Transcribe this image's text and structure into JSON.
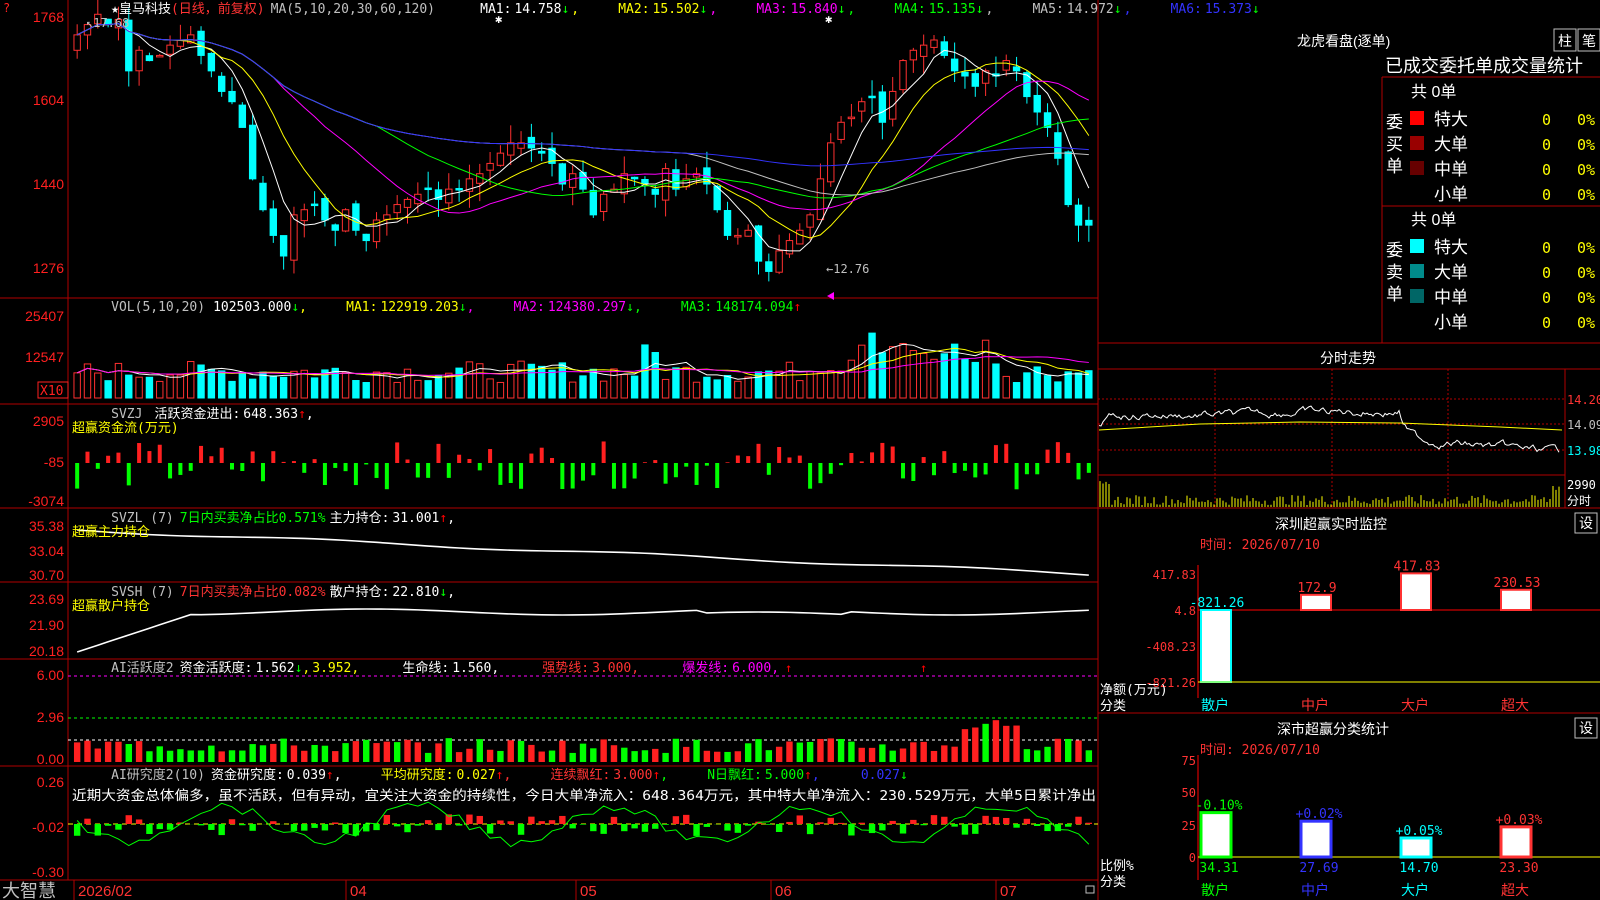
{
  "app": {
    "bottom_brand": "大智慧",
    "stock_name": "皇马科技",
    "stock_mode": "(日线，前复权)",
    "ma_line_label": "MA(5,10,20,30,60,120)",
    "ma_values": [
      {
        "label": "MA1:",
        "value": "14.758",
        "arrow": "↓",
        "color": "#ffffff"
      },
      {
        "label": "MA2:",
        "value": "15.502",
        "arrow": "↓",
        "color": "#ffff00"
      },
      {
        "label": "MA3:",
        "value": "15.840",
        "arrow": "↓",
        "color": "#ff00ff"
      },
      {
        "label": "MA4:",
        "value": "15.135",
        "arrow": "↓",
        "color": "#00ff00"
      },
      {
        "label": "MA5:",
        "value": "14.972",
        "arrow": "↓",
        "color": "#c0c0c0"
      },
      {
        "label": "MA6:",
        "value": "15.373",
        "arrow": "↓",
        "color": "#3333ff"
      }
    ],
    "high_marker": "17.68",
    "low_marker": "←12.76",
    "corner_marker": "?"
  },
  "panels": {
    "price": {
      "ticks": [
        "1768",
        "1604",
        "1440",
        "1276"
      ]
    },
    "volume": {
      "ticks": [
        "25407",
        "12547"
      ],
      "unit": "X10",
      "label": "VOL(5,10,20)",
      "vol": "102503.000",
      "vol_arrow": "↓",
      "mas": [
        {
          "t": "MA1:",
          "v": "122919.203",
          "a": "↓",
          "c": "#ffff00"
        },
        {
          "t": "MA2:",
          "v": "124380.297",
          "a": "↓",
          "c": "#ff00ff"
        },
        {
          "t": "MA3:",
          "v": "148174.094",
          "a": "↑",
          "c": "#00ff00"
        }
      ]
    },
    "svzj": {
      "ticks": [
        "2905",
        "-85",
        "-3074"
      ],
      "label": "SVZJ",
      "line1": "活跃资金进出:",
      "value": "648.363",
      "arrow": "↑",
      "line2": "超赢资金流(万元)"
    },
    "svzl": {
      "ticks": [
        "35.38",
        "33.04",
        "30.70"
      ],
      "label": "SVZL (7)",
      "text1": "7日内买卖净占比0.571%",
      "text2": "主力持仓:",
      "value": "31.001",
      "arrow": "↑",
      "line2": "超赢主力持仓"
    },
    "svsh": {
      "ticks": [
        "23.69",
        "21.90",
        "20.18"
      ],
      "label": "SVSH (7)",
      "text1": "7日内买卖净占比0.082%",
      "text2": "散户持仓:",
      "value": "22.810",
      "arrow": "↓",
      "line2": "超赢散户持仓"
    },
    "ai1": {
      "ticks": [
        "6.00",
        "2.96",
        "0.00"
      ],
      "label": "AI活跃度2",
      "t1": "资金活跃度:",
      "v1": "1.562",
      "a1": "↓",
      "v2": "3.952,",
      "t3": "生命线:",
      "v3": "1.560,",
      "t4": "强势线:",
      "v4": "3.000,",
      "t5": "爆发线:",
      "v5": "6.000,"
    },
    "ai2": {
      "ticks": [
        "0.26",
        "-0.02",
        "-0.30"
      ],
      "label": "AI研究度2(10)",
      "t1": "资金研究度:",
      "v1": "0.039",
      "a1": "↑",
      "t2": "平均研究度:",
      "v2": "0.027",
      "a2": "↑",
      "t3": "连续飘红:",
      "v3": "3.000",
      "a3": "↑",
      "t4": "N日飘红:",
      "v4": "5.000",
      "a4": "↑",
      "v5": "0.027",
      "a5": "↓",
      "comment": "近期大资金总体偏多，虽不活跃，但有异动，宜关注大资金的持续性，今日大单净流入：648.364万元，其中特大单净流入：230.529万元，大单5日累计净出"
    }
  },
  "x_axis": {
    "labels": [
      {
        "t": "2026/02",
        "x": 78
      },
      {
        "t": "04",
        "x": 350
      },
      {
        "t": "05",
        "x": 580
      },
      {
        "t": "06",
        "x": 775
      },
      {
        "t": "07",
        "x": 1000
      }
    ]
  },
  "right": {
    "dragon_title": "龙虎看盘(逐单)",
    "btn_col": "柱",
    "btn_pen": "笔",
    "order_header": "已成交委托单成交量统计",
    "buy": {
      "side": "委买单",
      "total": "共 0单",
      "rows": [
        {
          "name": "特大",
          "v": "0",
          "p": "0%",
          "c": "#ff0000"
        },
        {
          "name": "大单",
          "v": "0",
          "p": "0%",
          "c": "#990000"
        },
        {
          "name": "中单",
          "v": "0",
          "p": "0%",
          "c": "#660000"
        },
        {
          "name": "小单",
          "v": "0",
          "p": "0%",
          "c": "#000000"
        }
      ]
    },
    "sell": {
      "side": "委卖单",
      "total": "共 0单",
      "rows": [
        {
          "name": "特大",
          "v": "0",
          "p": "0%",
          "c": "#00ffff"
        },
        {
          "name": "大单",
          "v": "0",
          "p": "0%",
          "c": "#008b8b"
        },
        {
          "name": "中单",
          "v": "0",
          "p": "0%",
          "c": "#006666"
        },
        {
          "name": "小单",
          "v": "0",
          "p": "0%",
          "c": "#000000"
        }
      ]
    },
    "intraday_title": "分时走势",
    "intraday_ticks": [
      "14.20",
      "14.09",
      "13.98"
    ],
    "intraday_vol_tick": "2990",
    "intraday_vol_label": "分时",
    "monitor_title": "深圳超赢实时监控",
    "monitor_btn": "设",
    "monitor_time": "时间: 2026/07/10",
    "monitor_yticks": [
      "417.83",
      "4.8",
      "-408.23",
      "-821.26"
    ],
    "monitor_bars": [
      {
        "cat": "散户",
        "v": -821.26,
        "label": "-821.26"
      },
      {
        "cat": "中户",
        "v": 172.9,
        "label": "172.9"
      },
      {
        "cat": "大户",
        "v": 417.83,
        "label": "417.83"
      },
      {
        "cat": "超大",
        "v": 230.53,
        "label": "230.53"
      }
    ],
    "monitor_ylabel": "净额(万元)",
    "monitor_xlabel": "分类",
    "stat_title": "深市超赢分类统计",
    "stat_btn": "设",
    "stat_time": "时间: 2026/07/10",
    "stat_yticks": [
      "75",
      "50",
      "25",
      "0"
    ],
    "stat_bars": [
      {
        "cat": "散户",
        "v": 34.31,
        "label": "34.31",
        "chg": "-0.10%"
      },
      {
        "cat": "中户",
        "v": 27.69,
        "label": "27.69",
        "chg": "+0.02%"
      },
      {
        "cat": "大户",
        "v": 14.7,
        "label": "14.70",
        "chg": "+0.05%"
      },
      {
        "cat": "超大",
        "v": 23.3,
        "label": "23.30",
        "chg": "+0.03%"
      }
    ],
    "stat_ylabel": "比例%",
    "stat_xlabel": "分类"
  },
  "chart_data": [
    {
      "type": "candlestick",
      "title": "皇马科技 (日线，前复权)",
      "ylim": [
        12.3,
        17.9
      ],
      "yticks": [
        17.68,
        16.04,
        14.4,
        12.76
      ],
      "x_range": [
        "2026/02",
        "2026/07"
      ],
      "close": [
        17.3,
        17.5,
        17.7,
        17.5,
        17.6,
        16.6,
        17.0,
        16.8,
        16.9,
        17.1,
        17.2,
        17.3,
        16.9,
        16.6,
        16.2,
        16.0,
        15.5,
        14.5,
        13.9,
        13.4,
        13.0,
        13.8,
        13.9,
        14.0,
        13.7,
        13.5,
        13.9,
        13.5,
        13.3,
        13.7,
        13.8,
        14.0,
        14.1,
        14.2,
        14.3,
        14.1,
        14.3,
        14.3,
        14.5,
        14.6,
        14.8,
        15.0,
        15.2,
        15.2,
        15.1,
        15.0,
        14.8,
        14.4,
        14.6,
        14.3,
        13.8,
        14.2,
        14.3,
        14.6,
        14.5,
        14.4,
        14.2,
        14.7,
        14.3,
        14.5,
        14.6,
        14.4,
        13.9,
        13.4,
        13.4,
        13.5,
        12.9,
        12.7,
        13.1,
        13.3,
        13.5,
        13.8,
        14.5,
        15.2,
        15.6,
        15.7,
        16.0,
        16.1,
        15.6,
        16.2,
        16.8,
        17.0,
        17.1,
        17.2,
        16.9,
        16.6,
        16.5,
        16.3,
        16.6,
        16.5,
        16.8,
        16.6,
        16.1,
        15.8,
        15.5,
        14.9,
        14.0,
        13.6,
        13.6
      ],
      "ma_values": {
        "MA1": 14.758,
        "MA2": 15.502,
        "MA3": 15.84,
        "MA4": 15.135,
        "MA5": 14.972,
        "MA6": 15.373
      },
      "high": 17.68,
      "low": 12.76
    },
    {
      "type": "bar",
      "title": "VOL(5,10,20)",
      "ylim": [
        0,
        25407
      ],
      "last": 102503.0,
      "ma": {
        "MA1": 122919.203,
        "MA2": 124380.297,
        "MA3": 148174.094
      }
    },
    {
      "type": "bar",
      "title": "SVZJ 活跃资金进出",
      "ylim": [
        -3074,
        2905
      ],
      "last": 648.363
    },
    {
      "type": "line",
      "title": "SVZL 超赢主力持仓",
      "ylim": [
        30.7,
        35.38
      ],
      "last": 31.001
    },
    {
      "type": "line",
      "title": "SVSH 超赢散户持仓",
      "ylim": [
        20.18,
        23.69
      ],
      "last": 22.81
    },
    {
      "type": "bar",
      "title": "AI活跃度2",
      "ylim": [
        0,
        6
      ],
      "lines": {
        "生命线": 1.56,
        "强势线": 3.0,
        "爆发线": 6.0
      },
      "last": 1.562
    },
    {
      "type": "bar",
      "title": "AI研究度2(10)",
      "ylim": [
        -0.3,
        0.26
      ],
      "last": 0.039
    },
    {
      "type": "bar",
      "title": "深圳超赢实时监控",
      "categories": [
        "散户",
        "中户",
        "大户",
        "超大"
      ],
      "values": [
        -821.26,
        172.9,
        417.83,
        230.53
      ],
      "ylabel": "净额(万元)",
      "xlabel": "分类"
    },
    {
      "type": "bar",
      "title": "深市超赢分类统计",
      "categories": [
        "散户",
        "中户",
        "大户",
        "超大"
      ],
      "values": [
        34.31,
        27.69,
        14.7,
        23.3
      ],
      "changes": [
        "-0.10%",
        "+0.02%",
        "+0.05%",
        "+0.03%"
      ],
      "ylabel": "比例%",
      "xlabel": "分类",
      "ylim": [
        0,
        75
      ]
    }
  ]
}
